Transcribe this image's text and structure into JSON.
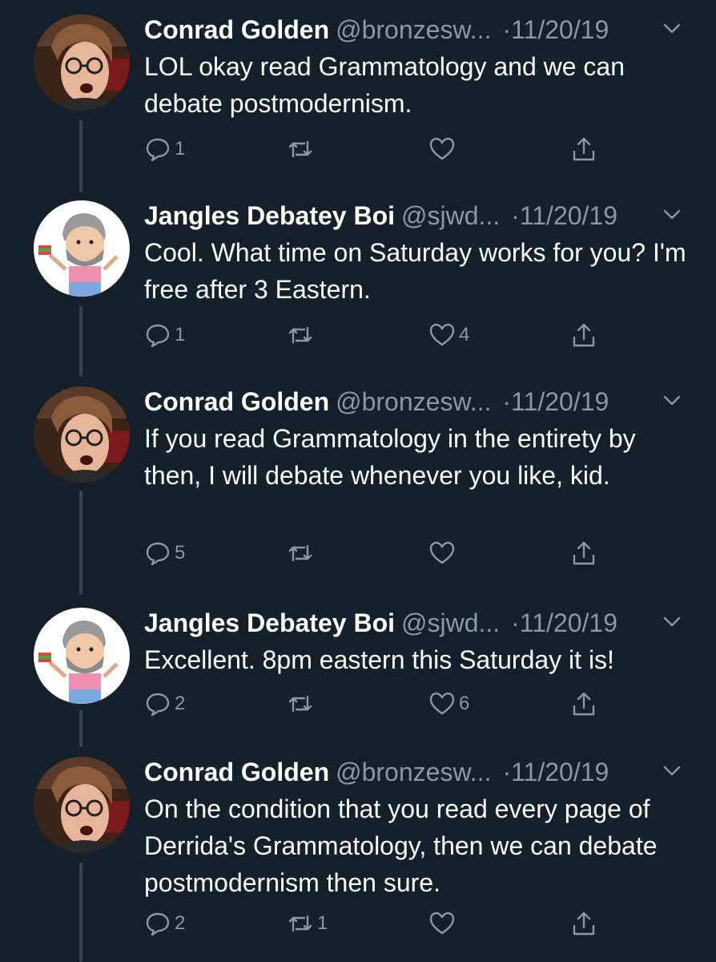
{
  "colors": {
    "background": "#15202b",
    "text": "#ffffff",
    "secondary": "#8899a6",
    "thread_line": "#38444d"
  },
  "tweets": [
    {
      "name": "Conrad Golden",
      "handle": "@bronzesw...",
      "dot": "·",
      "date": "11/20/19",
      "text": "LOL okay read Grammatology and we can debate postmodernism.",
      "avatar": "woman-glasses-avatar",
      "replies": "1",
      "retweets": "",
      "likes": "",
      "icons": [
        "reply-icon",
        "retweet-icon",
        "like-icon",
        "share-icon"
      ]
    },
    {
      "name": "Jangles Debatey Boi",
      "handle": "@sjwd...",
      "dot": "·",
      "date": "11/20/19",
      "text": "Cool. What time on Saturday works for you? I'm free after 3 Eastern.",
      "avatar": "cartoon-bearded-man-avatar",
      "replies": "1",
      "retweets": "",
      "likes": "4",
      "icons": [
        "reply-icon",
        "retweet-icon",
        "like-icon",
        "share-icon"
      ]
    },
    {
      "name": "Conrad Golden",
      "handle": "@bronzesw...",
      "dot": "·",
      "date": "11/20/19",
      "text": "If you read Grammatology in the entirety by then, I will debate whenever you like, kid.",
      "avatar": "woman-glasses-avatar",
      "replies": "5",
      "retweets": "",
      "likes": "",
      "icons": [
        "reply-icon",
        "retweet-icon",
        "like-icon",
        "share-icon"
      ]
    },
    {
      "name": "Jangles Debatey Boi",
      "handle": "@sjwd...",
      "dot": "·",
      "date": "11/20/19",
      "text": "Excellent. 8pm eastern this Saturday it is!",
      "avatar": "cartoon-bearded-man-avatar",
      "replies": "2",
      "retweets": "",
      "likes": "6",
      "icons": [
        "reply-icon",
        "retweet-icon",
        "like-icon",
        "share-icon"
      ]
    },
    {
      "name": "Conrad Golden",
      "handle": "@bronzesw...",
      "dot": "·",
      "date": "11/20/19",
      "text": "On the condition that you read every page of Derrida's Grammatology, then we can debate postmodernism then sure.",
      "avatar": "woman-glasses-avatar",
      "replies": "2",
      "retweets": "1",
      "likes": "",
      "icons": [
        "reply-icon",
        "retweet-icon",
        "like-icon",
        "share-icon"
      ]
    }
  ]
}
